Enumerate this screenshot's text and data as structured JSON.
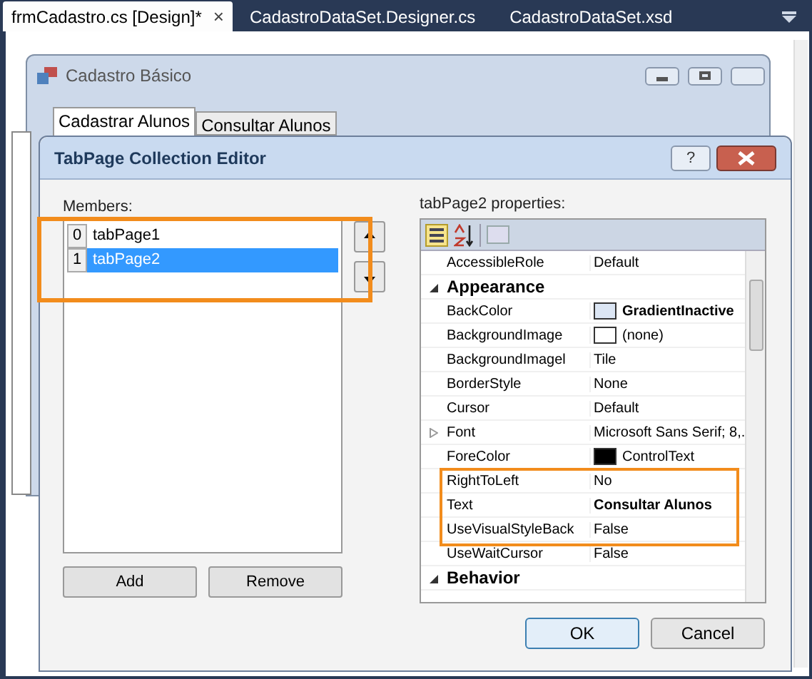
{
  "document_tabs": [
    {
      "label": "frmCadastro.cs [Design]*",
      "selected": true,
      "close": "×"
    },
    {
      "label": "CadastroDataSet.Designer.cs",
      "selected": false
    },
    {
      "label": "CadastroDataSet.xsd",
      "selected": false
    }
  ],
  "form": {
    "title": "Cadastro Básico",
    "tabs": [
      {
        "label": "Cadastrar Alunos",
        "selected": true
      },
      {
        "label": "Consultar Alunos",
        "selected": false
      }
    ]
  },
  "dialog": {
    "title": "TabPage Collection Editor",
    "help": "?",
    "members_label": "Members:",
    "members": [
      {
        "index": "0",
        "name": "tabPage1",
        "selected": false
      },
      {
        "index": "1",
        "name": "tabPage2",
        "selected": true
      }
    ],
    "add": "Add",
    "remove": "Remove",
    "properties_label": "tabPage2 properties:",
    "properties": [
      {
        "kind": "property",
        "name": "AccessibleRole",
        "value": "Default"
      },
      {
        "kind": "category",
        "name": "Appearance",
        "expanded": true
      },
      {
        "kind": "property",
        "name": "BackColor",
        "value": "GradientInactive",
        "color": "#dce6f4",
        "bold": true
      },
      {
        "kind": "property",
        "name": "BackgroundImage",
        "value": "(none)",
        "color": "#ffffff"
      },
      {
        "kind": "property",
        "name": "BackgroundImagel",
        "value": "Tile"
      },
      {
        "kind": "property",
        "name": "BorderStyle",
        "value": "None"
      },
      {
        "kind": "property",
        "name": "Cursor",
        "value": "Default"
      },
      {
        "kind": "property",
        "name": "Font",
        "value": "Microsoft Sans Serif; 8,.",
        "expandable": true
      },
      {
        "kind": "property",
        "name": "ForeColor",
        "value": "ControlText",
        "color": "#000000"
      },
      {
        "kind": "property",
        "name": "RightToLeft",
        "value": "No"
      },
      {
        "kind": "property",
        "name": "Text",
        "value": "Consultar Alunos",
        "bold": true
      },
      {
        "kind": "property",
        "name": "UseVisualStyleBack",
        "value": "False"
      },
      {
        "kind": "property",
        "name": "UseWaitCursor",
        "value": "False"
      },
      {
        "kind": "category",
        "name": "Behavior",
        "expanded": true
      }
    ],
    "ok": "OK",
    "cancel": "Cancel"
  }
}
